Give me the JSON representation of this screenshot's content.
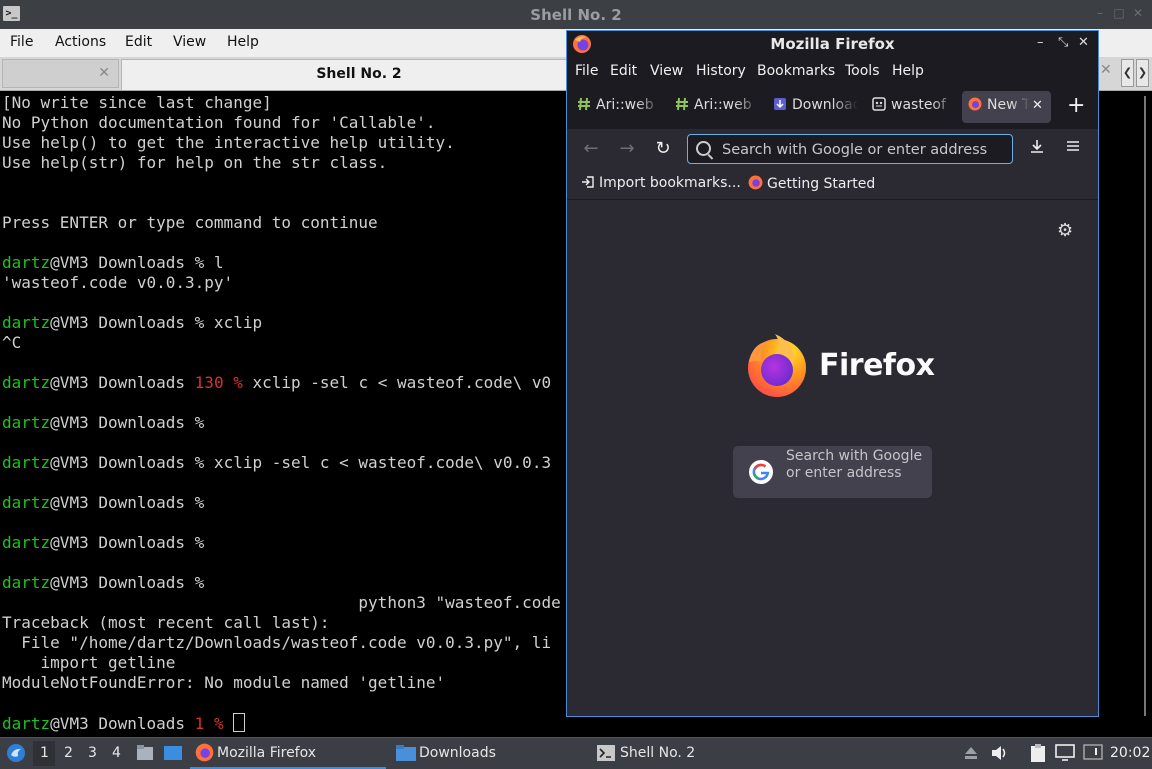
{
  "terminal": {
    "title": "Shell No. 2",
    "menu": [
      "File",
      "Actions",
      "Edit",
      "View",
      "Help"
    ],
    "tab_active": "Shell No. 2",
    "lines": [
      [
        {
          "t": "[No write since last change]"
        }
      ],
      [
        {
          "t": "No Python documentation found for 'Callable'."
        }
      ],
      [
        {
          "t": "Use help() to get the interactive help utility."
        }
      ],
      [
        {
          "t": "Use help(str) for help on the str class."
        }
      ],
      [
        {
          "t": ""
        }
      ],
      [
        {
          "t": ""
        }
      ],
      [
        {
          "t": "Press ENTER or type command to continue"
        }
      ],
      [
        {
          "t": ""
        }
      ],
      [
        {
          "t": "dartz",
          "c": "pg"
        },
        {
          "t": "@VM3 Downloads % l"
        }
      ],
      [
        {
          "t": "'wasteof.code v0.0.3.py'"
        }
      ],
      [
        {
          "t": ""
        }
      ],
      [
        {
          "t": "dartz",
          "c": "pg"
        },
        {
          "t": "@VM3 Downloads % xclip"
        }
      ],
      [
        {
          "t": "^C"
        }
      ],
      [
        {
          "t": ""
        }
      ],
      [
        {
          "t": "dartz",
          "c": "pg"
        },
        {
          "t": "@VM3 Downloads "
        },
        {
          "t": "130 %",
          "c": "pr"
        },
        {
          "t": " xclip -sel c < wasteof.code\\ v0"
        }
      ],
      [
        {
          "t": ""
        }
      ],
      [
        {
          "t": "dartz",
          "c": "pg"
        },
        {
          "t": "@VM3 Downloads %"
        }
      ],
      [
        {
          "t": ""
        }
      ],
      [
        {
          "t": "dartz",
          "c": "pg"
        },
        {
          "t": "@VM3 Downloads % xclip -sel c < wasteof.code\\ v0.0.3"
        }
      ],
      [
        {
          "t": ""
        }
      ],
      [
        {
          "t": "dartz",
          "c": "pg"
        },
        {
          "t": "@VM3 Downloads %"
        }
      ],
      [
        {
          "t": ""
        }
      ],
      [
        {
          "t": "dartz",
          "c": "pg"
        },
        {
          "t": "@VM3 Downloads %"
        }
      ],
      [
        {
          "t": ""
        }
      ],
      [
        {
          "t": "dartz",
          "c": "pg"
        },
        {
          "t": "@VM3 Downloads %"
        }
      ],
      [
        {
          "t": "                                     python3 \"wasteof.code"
        }
      ],
      [
        {
          "t": "Traceback (most recent call last):"
        }
      ],
      [
        {
          "t": "  File \"/home/dartz/Downloads/wasteof.code v0.0.3.py\", li"
        }
      ],
      [
        {
          "t": "    import getline"
        }
      ],
      [
        {
          "t": "ModuleNotFoundError: No module named 'getline'"
        }
      ],
      [
        {
          "t": ""
        }
      ],
      [
        {
          "t": "dartz",
          "c": "pg"
        },
        {
          "t": "@VM3 Downloads "
        },
        {
          "t": "1 %",
          "c": "pr"
        },
        {
          "t": " "
        },
        {
          "cursor": true
        }
      ]
    ]
  },
  "firefox": {
    "title": "Mozilla Firefox",
    "menu": {
      "file": "File",
      "edit": "Edit",
      "view": "View",
      "history": "History",
      "bookmarks": "Bookmarks",
      "tools": "Tools",
      "help": "Help"
    },
    "tabs": {
      "t1": "Ari::web",
      "t2": "Ari::web",
      "t3": "Download",
      "t4": "wasteof",
      "t5": "New Tab"
    },
    "search_placeholder": "Search with Google or enter address",
    "bookmarks": {
      "import": "Import bookmarks...",
      "getting_started": "Getting Started"
    },
    "brand": "Firefox",
    "newtab_search": "Search with Google or enter address"
  },
  "taskbar": {
    "workspaces": {
      "w1": "1",
      "w2": "2",
      "w3": "3",
      "w4": "4"
    },
    "tasks": {
      "firefox": "Mozilla Firefox",
      "downloads": "Downloads",
      "shell": "Shell No. 2"
    },
    "clock": "20:02"
  }
}
